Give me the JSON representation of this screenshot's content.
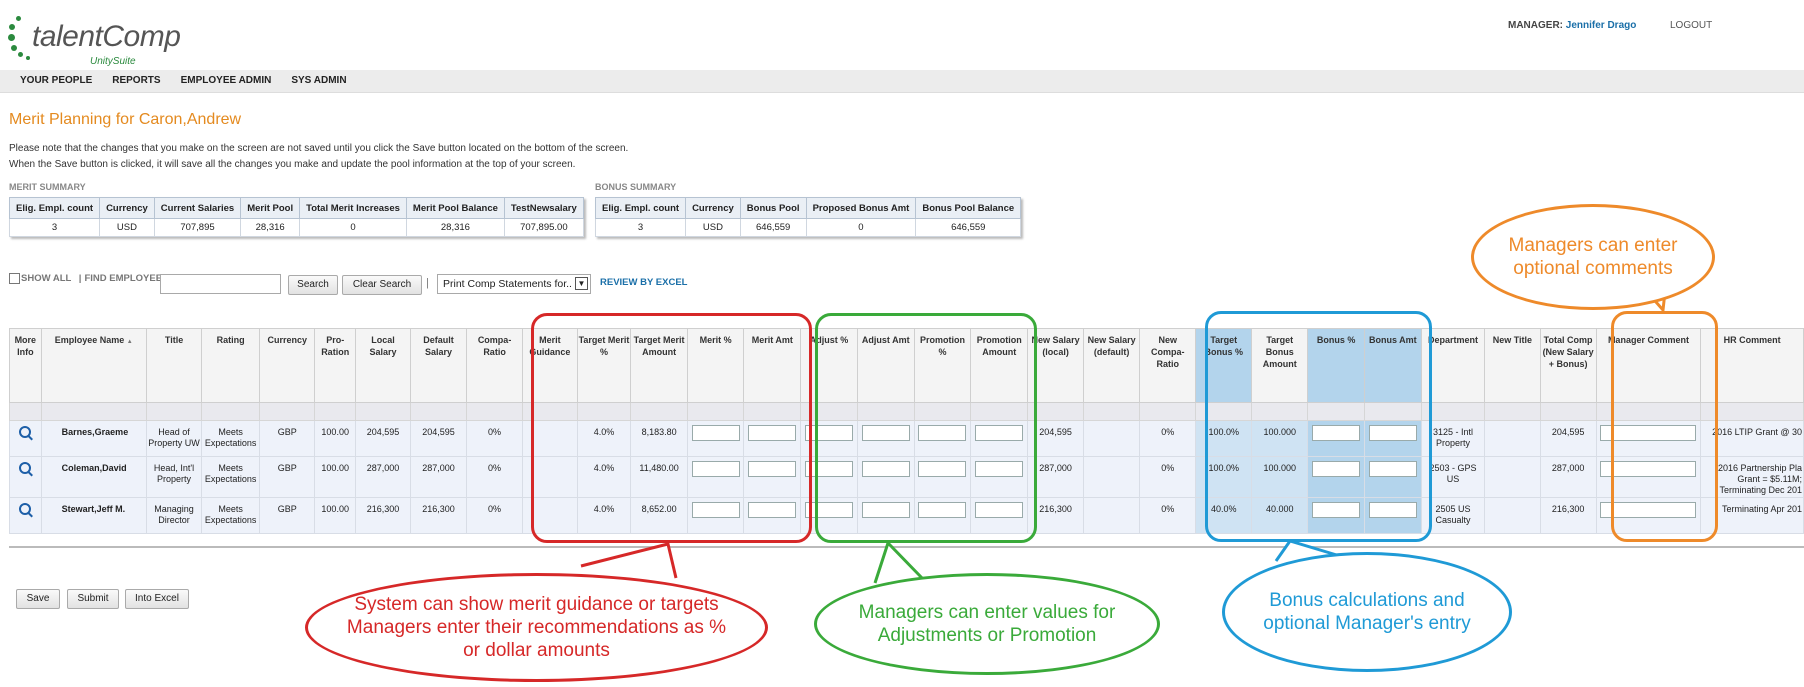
{
  "header": {
    "logo_main": "talentComp",
    "logo_sub": "UnitySuite",
    "manager_label": "MANAGER:",
    "manager_name": "Jennifer Drago",
    "logout": "LOGOUT"
  },
  "nav": [
    "YOUR PEOPLE",
    "REPORTS",
    "EMPLOYEE ADMIN",
    "SYS ADMIN"
  ],
  "page": {
    "title": "Merit Planning for Caron,Andrew",
    "note1": "Please note that the changes that you make on the screen are not saved until you click the Save button located on the bottom of the screen.",
    "note2": "When the Save button is clicked, it will save all the changes you make and update the pool information at the top of your screen."
  },
  "merit_summary": {
    "title": "MERIT SUMMARY",
    "headers": [
      "Elig. Empl. count",
      "Currency",
      "Current Salaries",
      "Merit Pool",
      "Total Merit Increases",
      "Merit Pool Balance",
      "TestNewsalary"
    ],
    "values": [
      "3",
      "USD",
      "707,895",
      "28,316",
      "0",
      "28,316",
      "707,895.00"
    ]
  },
  "bonus_summary": {
    "title": "BONUS SUMMARY",
    "headers": [
      "Elig. Empl. count",
      "Currency",
      "Bonus Pool",
      "Proposed Bonus Amt",
      "Bonus Pool Balance"
    ],
    "values": [
      "3",
      "USD",
      "646,559",
      "0",
      "646,559"
    ]
  },
  "filters": {
    "show_all": "SHOW ALL",
    "separator": "|",
    "find_employee": "FIND EMPLOYEE:",
    "search": "Search",
    "clear_search": "Clear Search",
    "separator2": "|",
    "print_select": "Print Comp Statements for..",
    "review_excel": "REVIEW BY EXCEL"
  },
  "grid": {
    "columns": [
      "More Info",
      "Employee Name",
      "Title",
      "Rating",
      "Currency",
      "Pro-Ration",
      "Local Salary",
      "Default Salary",
      "Compa-Ratio",
      "Merit Guidance",
      "Target Merit %",
      "Target Merit Amount",
      "Merit %",
      "Merit Amt",
      "Adjust %",
      "Adjust Amt",
      "Promotion %",
      "Promotion Amount",
      "New Salary (local)",
      "New Salary (default)",
      "New Compa-Ratio",
      "Target Bonus %",
      "Target Bonus Amount",
      "Bonus %",
      "Bonus Amt",
      "Department",
      "New Title",
      "Total Comp (New Salary + Bonus)",
      "Manager Comment",
      "HR Comment"
    ],
    "sort_indicator": "▲",
    "rows": [
      {
        "name": "Barnes,Graeme",
        "title": "Head of Property UW",
        "rating": "Meets Expectations",
        "currency": "GBP",
        "proration": "100.00",
        "local_salary": "204,595",
        "default_salary": "204,595",
        "compa": "0%",
        "merit_guidance": "",
        "target_merit_pct": "4.0%",
        "target_merit_amt": "8,183.80",
        "new_salary_local": "204,595",
        "new_salary_default": "",
        "new_compa": "0%",
        "target_bonus_pct": "100.0%",
        "target_bonus_amt": "100.000",
        "department": "3125 - Intl Property",
        "new_title": "",
        "total_comp": "204,595",
        "hr_comment": "2016 LTIP Grant @ 30"
      },
      {
        "name": "Coleman,David",
        "title": "Head, Int'l Property",
        "rating": "Meets Expectations",
        "currency": "GBP",
        "proration": "100.00",
        "local_salary": "287,000",
        "default_salary": "287,000",
        "compa": "0%",
        "merit_guidance": "",
        "target_merit_pct": "4.0%",
        "target_merit_amt": "11,480.00",
        "new_salary_local": "287,000",
        "new_salary_default": "",
        "new_compa": "0%",
        "target_bonus_pct": "100.0%",
        "target_bonus_amt": "100.000",
        "department": "2503 - GPS US",
        "new_title": "",
        "total_comp": "287,000",
        "hr_comment": "2016 Partnership Pla Grant = $5.11M; Terminating Dec 201"
      },
      {
        "name": "Stewart,Jeff M.",
        "title": "Managing Director",
        "rating": "Meets Expectations",
        "currency": "GBP",
        "proration": "100.00",
        "local_salary": "216,300",
        "default_salary": "216,300",
        "compa": "0%",
        "merit_guidance": "",
        "target_merit_pct": "4.0%",
        "target_merit_amt": "8,652.00",
        "new_salary_local": "216,300",
        "new_salary_default": "",
        "new_compa": "0%",
        "target_bonus_pct": "40.0%",
        "target_bonus_amt": "40.000",
        "department": "2505 US Casualty",
        "new_title": "",
        "total_comp": "216,300",
        "hr_comment": "Terminating Apr 201"
      }
    ]
  },
  "footer_buttons": [
    "Save",
    "Submit",
    "Into Excel"
  ],
  "annotations": {
    "merit": "System can show merit guidance or targets Managers enter their recommendations as % or dollar amounts",
    "adjust": "Managers can enter values for Adjustments or Promotion",
    "bonus": "Bonus calculations and optional Manager's entry",
    "comment": "Managers can enter optional comments",
    "colors": {
      "merit": "#d62828",
      "adjust": "#3aaa3a",
      "bonus": "#1f9ad6",
      "comment": "#ee8a2a"
    }
  }
}
